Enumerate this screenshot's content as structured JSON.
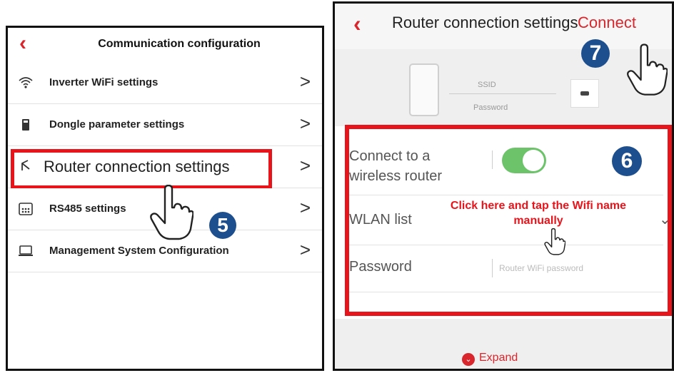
{
  "left": {
    "back_icon": "‹",
    "title": "Communication configuration",
    "items": [
      {
        "label": "Inverter WiFi settings",
        "icon": "wifi-icon",
        "chevron": ">"
      },
      {
        "label": "Dongle parameter settings",
        "icon": "dongle-icon",
        "chevron": ">"
      },
      {
        "label": "Router connection settings",
        "icon": "router-icon",
        "chevron": ">"
      },
      {
        "label": "RS485 settings",
        "icon": "rs485-icon",
        "chevron": ">"
      },
      {
        "label": "Management System Configuration",
        "icon": "monitor-icon",
        "chevron": ">"
      }
    ],
    "step_badge": "5"
  },
  "right": {
    "back_icon": "‹",
    "title": "Router connection settings",
    "connect_label": "Connect",
    "step_badge_connect": "7",
    "diagram": {
      "ssid": "SSID",
      "password": "Password"
    },
    "fields": {
      "connect_router_label": "Connect to a wireless router",
      "wlan_label": "WLAN list",
      "password_label": "Password",
      "password_placeholder": "Router WiFi password"
    },
    "step_badge_form": "6",
    "note": "Click here and tap the Wifi name manually",
    "expand_label": "Expand"
  },
  "colors": {
    "accent": "#d9262c",
    "highlight": "#e8141c",
    "badge": "#1d4f8f",
    "toggle_on": "#6cc36a"
  }
}
